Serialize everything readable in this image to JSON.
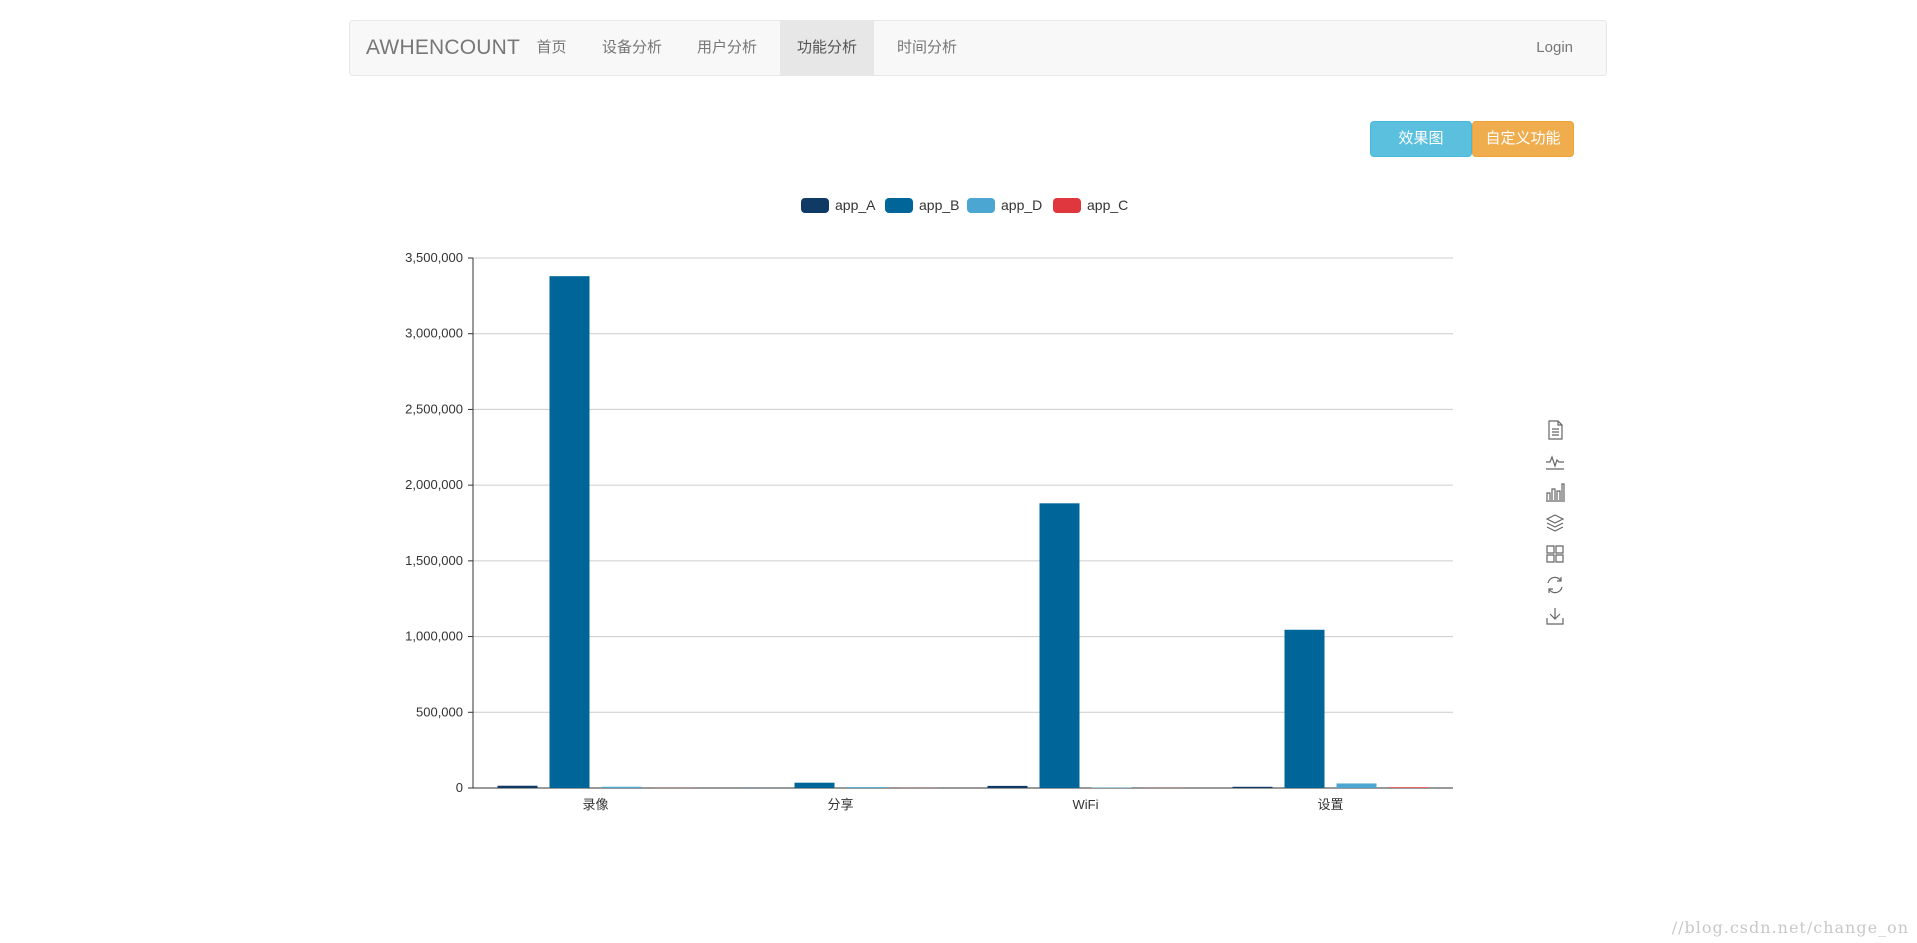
{
  "navbar": {
    "brand": "AWHENCOUNT",
    "items": [
      {
        "label": "首页",
        "active": false
      },
      {
        "label": "设备分析",
        "active": false
      },
      {
        "label": "用户分析",
        "active": false
      },
      {
        "label": "功能分析",
        "active": true
      },
      {
        "label": "时间分析",
        "active": false
      }
    ],
    "login": "Login"
  },
  "buttons": {
    "effect": "效果图",
    "custom": "自定义功能"
  },
  "toolbox": [
    "data-view-icon",
    "line-chart-icon",
    "bar-chart-icon",
    "stack-icon",
    "tiled-icon",
    "restore-icon",
    "save-image-icon"
  ],
  "watermark": "//blog.csdn.net/change_on",
  "chart_data": {
    "type": "bar",
    "categories": [
      "录像",
      "分享",
      "WiFi",
      "设置"
    ],
    "series": [
      {
        "name": "app_A",
        "color": "#0f3a66",
        "values": [
          15000,
          2000,
          14000,
          8000
        ]
      },
      {
        "name": "app_B",
        "color": "#006699",
        "values": [
          3380000,
          35000,
          1880000,
          1045000
        ]
      },
      {
        "name": "app_D",
        "color": "#4ba7d1",
        "values": [
          8000,
          6000,
          3000,
          30000
        ]
      },
      {
        "name": "app_C",
        "color": "#e0363d",
        "values": [
          1000,
          1000,
          1000,
          5000
        ]
      }
    ],
    "ylim": [
      0,
      3500000
    ],
    "yticks": [
      "0",
      "500,000",
      "1,000,000",
      "1,500,000",
      "2,000,000",
      "2,500,000",
      "3,000,000",
      "3,500,000"
    ],
    "ytick_values": [
      0,
      500000,
      1000000,
      1500000,
      2000000,
      2500000,
      3000000,
      3500000
    ],
    "grid": true,
    "legend": "top-center"
  }
}
